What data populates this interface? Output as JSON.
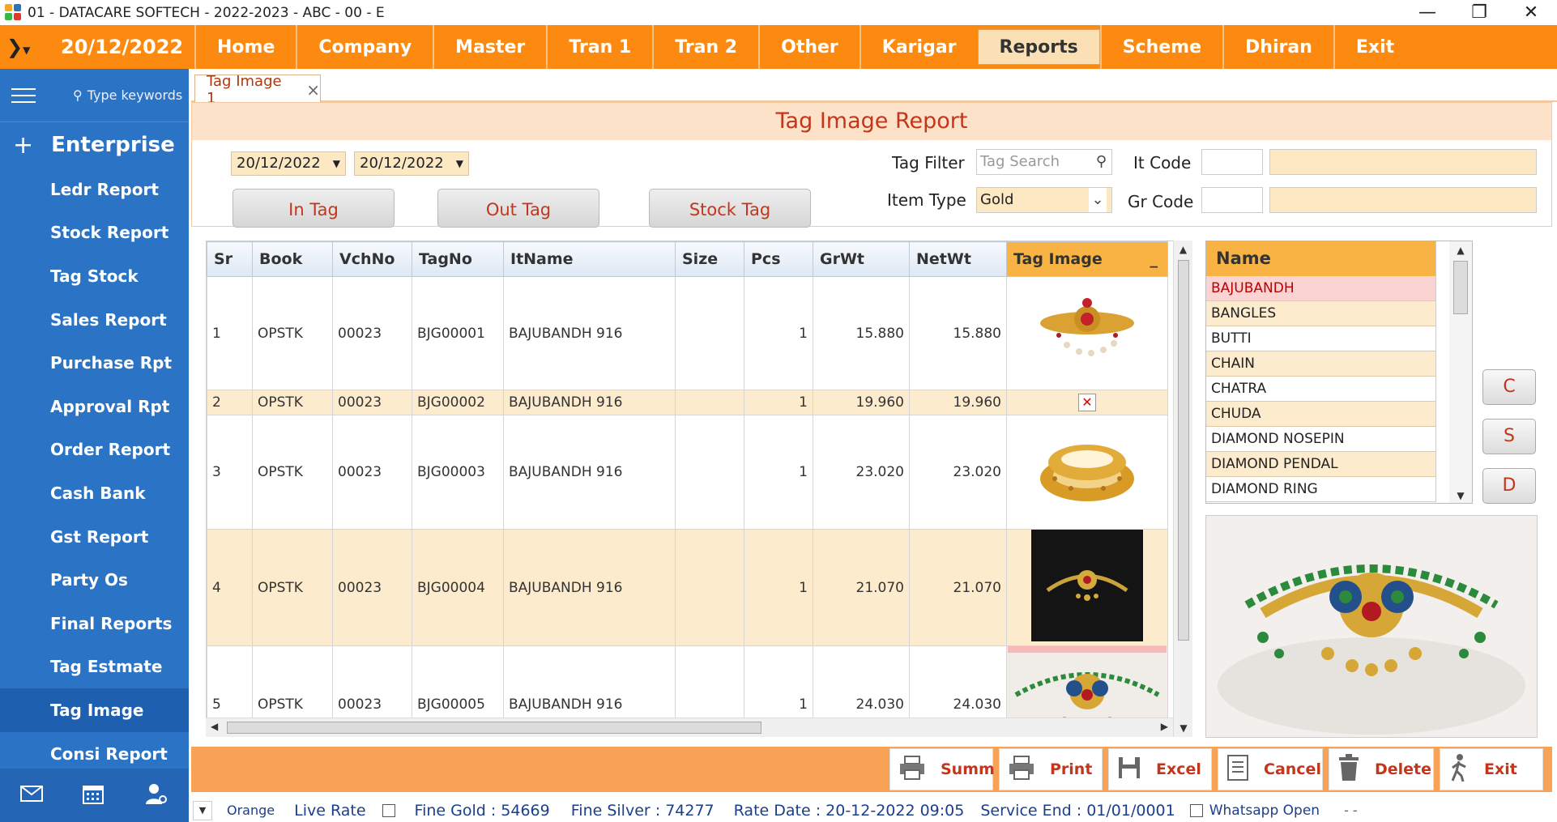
{
  "window": {
    "title": "01 - DATACARE SOFTECH - 2022-2023 - ABC - 00 - E"
  },
  "menubar": {
    "date": "20/12/2022",
    "items": [
      "Home",
      "Company",
      "Master",
      "Tran 1",
      "Tran 2",
      "Other",
      "Karigar",
      "Reports",
      "Scheme",
      "Dhiran",
      "Exit"
    ],
    "active": "Reports"
  },
  "sidebar": {
    "search_placeholder": "Type keywords",
    "section": "Enterprise",
    "items": [
      "Ledr Report",
      "Stock Report",
      "Tag Stock",
      "Sales Report",
      "Purchase Rpt",
      "Approval Rpt",
      "Order Report",
      "Cash Bank",
      "Gst Report",
      "Party Os",
      "Final Reports",
      "Tag Estmate",
      "Tag Image",
      "Consi Report"
    ],
    "selected": "Tag Image"
  },
  "tab": {
    "label": "Tag Image 1",
    "close": "×"
  },
  "report": {
    "title": "Tag Image Report",
    "date_from": "20/12/2022",
    "date_to": "20/12/2022",
    "buttons": {
      "in_tag": "In Tag",
      "out_tag": "Out Tag",
      "stock_tag": "Stock Tag"
    },
    "tag_filter_label": "Tag Filter",
    "tag_search_placeholder": "Tag Search",
    "item_type_label": "Item Type",
    "item_type_value": "Gold",
    "it_code_label": "It Code",
    "gr_code_label": "Gr Code"
  },
  "grid": {
    "columns": [
      "Sr",
      "Book",
      "VchNo",
      "TagNo",
      "ItName",
      "Size",
      "Pcs",
      "GrWt",
      "NetWt",
      "Tag Image"
    ],
    "sort_indicator": "_",
    "rows": [
      {
        "sr": "1",
        "book": "OPSTK",
        "vch": "00023",
        "tag": "BJG00001",
        "item": "BAJUBANDH 916",
        "size": "",
        "pcs": "1",
        "grwt": "15.880",
        "netwt": "15.880",
        "image": "bajubandh-red-image"
      },
      {
        "sr": "2",
        "book": "OPSTK",
        "vch": "00023",
        "tag": "BJG00002",
        "item": "BAJUBANDH 916",
        "size": "",
        "pcs": "1",
        "grwt": "19.960",
        "netwt": "19.960",
        "image": "broken-image-icon"
      },
      {
        "sr": "3",
        "book": "OPSTK",
        "vch": "00023",
        "tag": "BJG00003",
        "item": "BAJUBANDH 916",
        "size": "",
        "pcs": "1",
        "grwt": "23.020",
        "netwt": "23.020",
        "image": "bangles-image"
      },
      {
        "sr": "4",
        "book": "OPSTK",
        "vch": "00023",
        "tag": "BJG00004",
        "item": "BAJUBANDH 916",
        "size": "",
        "pcs": "1",
        "grwt": "21.070",
        "netwt": "21.070",
        "image": "bajubandh-dark-image"
      },
      {
        "sr": "5",
        "book": "OPSTK",
        "vch": "00023",
        "tag": "BJG00005",
        "item": "BAJUBANDH 916",
        "size": "",
        "pcs": "1",
        "grwt": "24.030",
        "netwt": "24.030",
        "image": "bajubandh-peacock-image"
      }
    ]
  },
  "names": {
    "header": "Name",
    "items": [
      "BAJUBANDH",
      "BANGLES",
      "BUTTI",
      "CHAIN",
      "CHATRA",
      "CHUDA",
      "DIAMOND NOSEPIN",
      "DIAMOND PENDAL",
      "DIAMOND RING"
    ],
    "selected": "BAJUBANDH"
  },
  "side_buttons": [
    "C",
    "S",
    "D"
  ],
  "actions": [
    "Summ",
    "Print",
    "Excel",
    "Cancel",
    "Delete",
    "Exit"
  ],
  "status": {
    "theme": "Orange",
    "live_rate": "Live Rate",
    "fine_gold": "Fine Gold : 54669",
    "fine_silver": "Fine Silver : 74277",
    "rate_date": "Rate Date : 20-12-2022 09:05",
    "service_end": "Service End :  01/01/0001",
    "whatsapp": "Whatsapp Open",
    "dashes": "- -"
  },
  "colors": {
    "menu": "#fc8a10",
    "sidebar": "#2a73c5",
    "accent_text": "#c4361c",
    "header_orange": "#f8b344"
  }
}
